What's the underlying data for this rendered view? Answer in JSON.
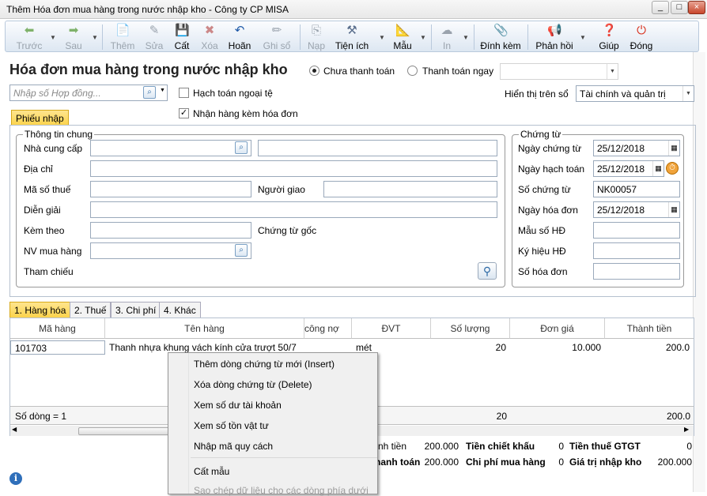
{
  "window": {
    "title": "Thêm Hóa đơn mua hàng trong nước nhập kho - Công ty CP MISA"
  },
  "toolbar": {
    "prev": "Trước",
    "next": "Sau",
    "add": "Thêm",
    "edit": "Sửa",
    "save": "Cất",
    "delete": "Xóa",
    "undo": "Hoãn",
    "post": "Ghi sổ",
    "load": "Nạp",
    "utilities": "Tiện ích",
    "template": "Mẫu",
    "print": "In",
    "attach": "Đính kèm",
    "feedback": "Phản hồi",
    "help": "Giúp",
    "close": "Đóng"
  },
  "form": {
    "title": "Hóa đơn mua hàng trong nước nhập kho",
    "unpaid": "Chưa thanh toán",
    "paid_now": "Thanh toán ngay",
    "contract_placeholder": "Nhập số Hợp đồng...",
    "foreign_accounting": "Hạch toán ngoại tệ",
    "receive_with_invoice": "Nhận hàng kèm hóa đơn",
    "display_on_book_label": "Hiển thị trên sổ",
    "display_on_book_value": "Tài chính và quản trị",
    "receipt_tab": "Phiếu nhập"
  },
  "general": {
    "title": "Thông tin chung",
    "supplier": "Nhà cung cấp",
    "address": "Địa chỉ",
    "tax_code": "Mã số thuế",
    "deliverer": "Người giao",
    "description": "Diễn giải",
    "attached": "Kèm theo",
    "original_docs": "Chứng từ gốc",
    "purchaser": "NV mua hàng",
    "reference": "Tham chiếu"
  },
  "voucher": {
    "title": "Chứng từ",
    "voucher_date_label": "Ngày chứng từ",
    "voucher_date": "25/12/2018",
    "posting_date_label": "Ngày hạch toán",
    "posting_date": "25/12/2018",
    "voucher_no_label": "Số chứng từ",
    "voucher_no": "NK00057",
    "invoice_date_label": "Ngày hóa đơn",
    "invoice_date": "25/12/2018",
    "invoice_form_label": "Mẫu số HĐ",
    "invoice_symbol_label": "Ký hiệu HĐ",
    "invoice_no_label": "Số hóa đơn"
  },
  "detail_tabs": [
    "1. Hàng hóa",
    "2. Thuế",
    "3. Chi phí",
    "4. Khác"
  ],
  "grid": {
    "headers": [
      "Mã hàng",
      "Tên hàng",
      "công nợ",
      "ĐVT",
      "Số lượng",
      "Đơn giá",
      "Thành tiền"
    ],
    "row": {
      "code": "101703",
      "name": "Thanh nhựa khung vách kính cửa trượt 50/7",
      "unit": "mét",
      "qty": "20",
      "price": "10.000",
      "amount": "200.0"
    },
    "row_count": "Số dòng = 1",
    "sum_qty": "20",
    "sum_amount": "200.0"
  },
  "totals": {
    "subtotal_label_partial": "nh tiền",
    "subtotal": "200.000",
    "discount_label": "Tiền chiết khấu",
    "discount": "0",
    "vat_label": "Tiền thuế GTGT",
    "vat": "0",
    "payment_label_partial": "thanh toán",
    "payment": "200.000",
    "purchase_cost_label": "Chi phí mua hàng",
    "purchase_cost": "0",
    "stock_value_label": "Giá trị nhập kho",
    "stock_value": "200.000"
  },
  "context_menu": {
    "insert": "Thêm dòng chứng từ mới (Insert)",
    "delete": "Xóa dòng chứng từ (Delete)",
    "account_balance": "Xem số dư tài khoản",
    "stock": "Xem số tồn vật tư",
    "spec": "Nhập mã quy cách",
    "save_template": "Cất mẫu",
    "copy_down": "Sao chép dữ liệu cho các dòng phía dưới"
  }
}
